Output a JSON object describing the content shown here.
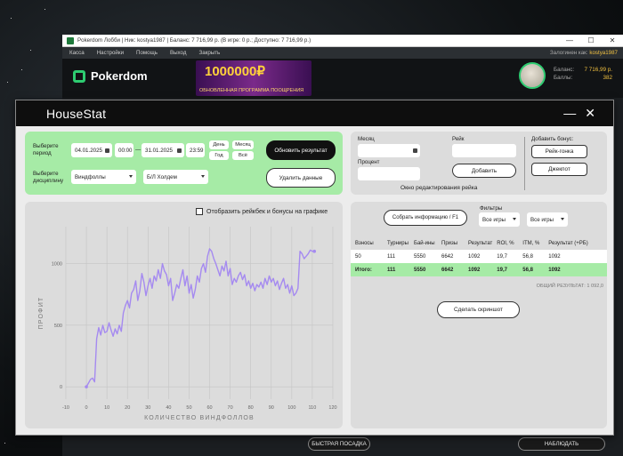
{
  "pokerdom": {
    "window_title": "Pokerdom Лобби | Ник: kostya1987 | Баланс: 7 716,99 р. (В игре: 0 р.; Доступно: 7 716,99 р.)",
    "window_controls": [
      "—",
      "☐",
      "✕"
    ],
    "menu": [
      "Касса",
      "Настройки",
      "Помощь",
      "Выход",
      "Закрыть"
    ],
    "login_label": "Залогинен как:",
    "login_user": "kostya1987",
    "logo_text": "Pokerdom",
    "banner_amount": "1000000₽",
    "banner_caption": "ОБНОВЛЕННАЯ ПРОГРАММА ПООЩРЕНИЯ",
    "balance_label": "Баланс:",
    "points_label": "Баллы:",
    "balance_value": "7 716,99 р.",
    "points_value": "382",
    "bottom_buttons": [
      "БЫСТРАЯ ПОСАДКА",
      "НАБЛЮДАТЬ"
    ]
  },
  "housestat": {
    "title": "HouseStat",
    "controls": [
      "—",
      "✕"
    ],
    "period": {
      "label": "Выберите период",
      "date_from": "04.01.2025",
      "time_from": "00:00",
      "dash": "—",
      "date_to": "31.01.2025",
      "time_to": "23:59",
      "quick": [
        "День",
        "Месяц",
        "Год",
        "Всё"
      ]
    },
    "discipline": {
      "label": "Выберите дисциплину",
      "game": "Виндфоллы",
      "variant": "Б/Л Холдем"
    },
    "update_button": "Обновить результат",
    "delete_button": "Удалить данные",
    "rake_editor": {
      "month_label": "Месяц",
      "rake_label": "Рейк",
      "percent_label": "Процент",
      "add_button": "Добавить",
      "caption": "Окно редактирования рейка",
      "bonus_label": "Добавить бонус:",
      "bonus_buttons": [
        "Рейк-гонка",
        "Джекпот"
      ]
    },
    "chart_checkbox_label": "Отобразить рейкбек и бонусы на графике",
    "collect_button": "Собрать информацию / F1",
    "filters": {
      "label": "Фильтры",
      "filter1": "Все игры",
      "filter2": "Все игры"
    },
    "table": {
      "headers": [
        "Взносы",
        "Турниры",
        "Бай-ины",
        "Призы",
        "Результат",
        "ROI, %",
        "ITM, %",
        "Результат (+РБ)"
      ],
      "row": [
        "50",
        "111",
        "5550",
        "6642",
        "1092",
        "19,7",
        "56,8",
        "1092"
      ],
      "total": [
        "Итого:",
        "111",
        "5550",
        "6642",
        "1092",
        "19,7",
        "56,8",
        "1092"
      ]
    },
    "total_result": "ОБЩИЙ РЕЗУЛЬТАТ:  1 092,0",
    "screenshot_button": "Сделать скриншот"
  },
  "chart_data": {
    "type": "line",
    "xlabel": "КОЛИЧЕСТВО ВИНДФОЛЛОВ",
    "ylabel": "ПРОФИТ",
    "xlim": [
      -10,
      120
    ],
    "ylim": [
      -100,
      1300
    ],
    "x_ticks": [
      -10,
      0,
      10,
      20,
      30,
      40,
      50,
      60,
      70,
      80,
      90,
      100,
      110,
      120
    ],
    "y_ticks": [
      0,
      500,
      1000
    ],
    "grid": true,
    "line_color": "#a58af0",
    "x": [
      0,
      1,
      2,
      3,
      4,
      5,
      6,
      7,
      8,
      9,
      10,
      11,
      12,
      13,
      14,
      15,
      16,
      17,
      18,
      19,
      20,
      21,
      22,
      23,
      24,
      25,
      26,
      27,
      28,
      29,
      30,
      31,
      32,
      33,
      34,
      35,
      36,
      37,
      38,
      39,
      40,
      41,
      42,
      43,
      44,
      45,
      46,
      47,
      48,
      49,
      50,
      51,
      52,
      53,
      54,
      55,
      56,
      57,
      58,
      59,
      60,
      61,
      62,
      63,
      64,
      65,
      66,
      67,
      68,
      69,
      70,
      71,
      72,
      73,
      74,
      75,
      76,
      77,
      78,
      79,
      80,
      81,
      82,
      83,
      84,
      85,
      86,
      87,
      88,
      89,
      90,
      91,
      92,
      93,
      94,
      95,
      96,
      97,
      98,
      99,
      100,
      101,
      102,
      103,
      104,
      105,
      106,
      107,
      108,
      109,
      110,
      111
    ],
    "y": [
      0,
      30,
      60,
      70,
      40,
      390,
      480,
      420,
      500,
      440,
      450,
      520,
      460,
      410,
      470,
      430,
      500,
      450,
      600,
      660,
      700,
      640,
      760,
      790,
      860,
      700,
      780,
      920,
      850,
      740,
      820,
      880,
      800,
      900,
      860,
      950,
      880,
      1000,
      940,
      910,
      820,
      880,
      700,
      760,
      830,
      800,
      880,
      950,
      820,
      900,
      760,
      830,
      720,
      790,
      900,
      850,
      960,
      1000,
      930,
      1060,
      1120,
      1100,
      1040,
      1000,
      950,
      900,
      980,
      940,
      1020,
      900,
      960,
      830,
      880,
      850,
      900,
      930,
      870,
      910,
      820,
      860,
      800,
      840,
      780,
      830,
      810,
      850,
      800,
      880,
      830,
      900,
      850,
      880,
      820,
      860,
      790,
      840,
      880,
      800,
      830,
      760,
      820,
      740,
      760,
      800,
      1100,
      1080,
      1040,
      1060,
      1080,
      1110,
      1100,
      1100
    ]
  }
}
